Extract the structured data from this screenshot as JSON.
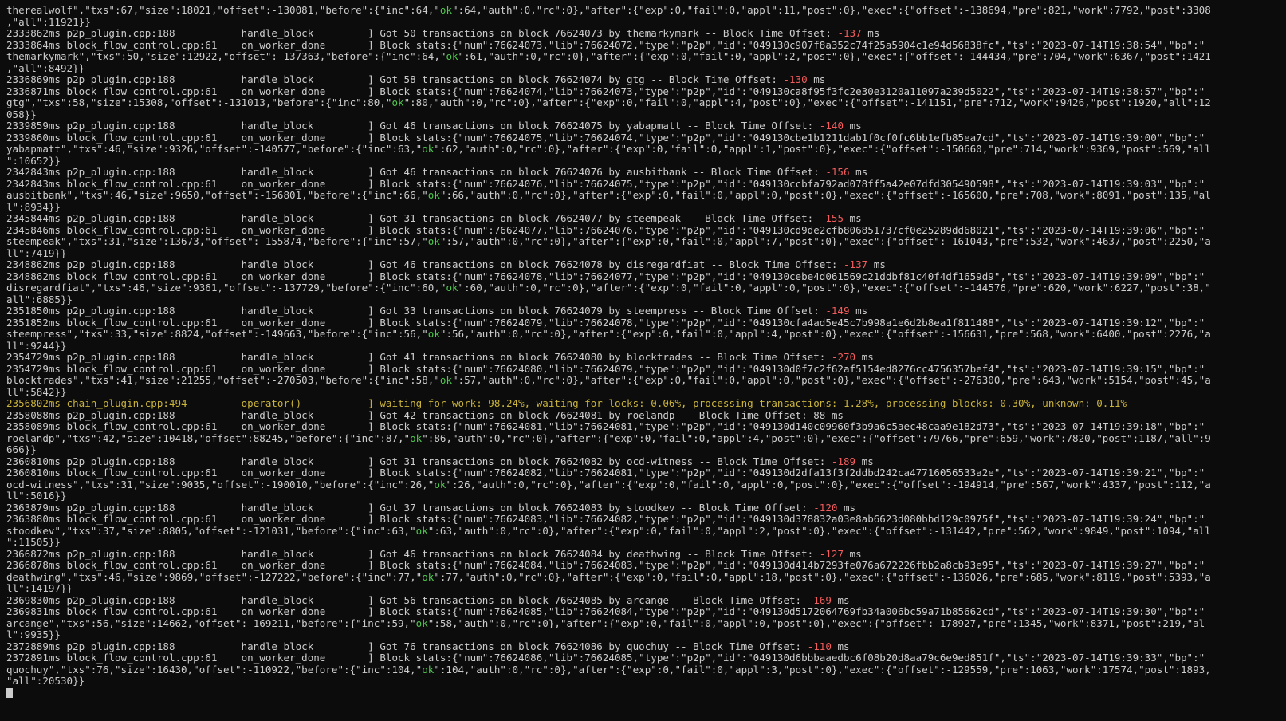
{
  "colors": {
    "background": "#0c0c0c",
    "text": "#cccccc",
    "ok": "#4ec94e",
    "offset_negative": "#f25c5c",
    "status_line": "#c9b33a"
  },
  "terminal": {
    "lines": [
      [
        {
          "t": "therealwolf\",\"txs\":67,\"size\":18021,\"offset\":-130081,\"before\":{\"inc\":64,\""
        },
        {
          "t": "ok",
          "c": "green"
        },
        {
          "t": "\":64,\"auth\":0,\"rc\":0},\"after\":{\"exp\":0,\"fail\":0,\"appl\":11,\"post\":0},\"exec\":{\"offset\":-138694,\"pre\":821,\"work\":7792,\"post\":3308"
        }
      ],
      [
        {
          "t": ",\"all\":11921}}"
        }
      ],
      [
        {
          "t": "2333862ms p2p_plugin.cpp:188           handle_block         ] Got 50 transactions on block 76624073 by themarkymark -- Block Time Offset: "
        },
        {
          "t": "-137",
          "c": "red"
        },
        {
          "t": " ms"
        }
      ],
      [
        {
          "t": "2333864ms block_flow_control.cpp:61    on_worker_done       ] Block stats:{\"num\":76624073,\"lib\":76624072,\"type\":\"p2p\",\"id\":\"049130c907f8a352c74f25a5904c1e94d56838fc\",\"ts\":\"2023-07-14T19:38:54\",\"bp\":\""
        }
      ],
      [
        {
          "t": "themarkymark\",\"txs\":50,\"size\":12922,\"offset\":-137363,\"before\":{\"inc\":64,\""
        },
        {
          "t": "ok",
          "c": "green"
        },
        {
          "t": "\":61,\"auth\":0,\"rc\":0},\"after\":{\"exp\":0,\"fail\":0,\"appl\":2,\"post\":0},\"exec\":{\"offset\":-144434,\"pre\":704,\"work\":6367,\"post\":1421"
        }
      ],
      [
        {
          "t": ",\"all\":8492}}"
        }
      ],
      [
        {
          "t": "2336869ms p2p_plugin.cpp:188           handle_block         ] Got 58 transactions on block 76624074 by gtg -- Block Time Offset: "
        },
        {
          "t": "-130",
          "c": "red"
        },
        {
          "t": " ms"
        }
      ],
      [
        {
          "t": "2336871ms block_flow_control.cpp:61    on_worker_done       ] Block stats:{\"num\":76624074,\"lib\":76624073,\"type\":\"p2p\",\"id\":\"049130ca8f95f3fc2e30e3120a11097a239d5022\",\"ts\":\"2023-07-14T19:38:57\",\"bp\":\""
        }
      ],
      [
        {
          "t": "gtg\",\"txs\":58,\"size\":15308,\"offset\":-131013,\"before\":{\"inc\":80,\""
        },
        {
          "t": "ok",
          "c": "green"
        },
        {
          "t": "\":80,\"auth\":0,\"rc\":0},\"after\":{\"exp\":0,\"fail\":0,\"appl\":4,\"post\":0},\"exec\":{\"offset\":-141151,\"pre\":712,\"work\":9426,\"post\":1920,\"all\":12"
        }
      ],
      [
        {
          "t": "058}}"
        }
      ],
      [
        {
          "t": "2339859ms p2p_plugin.cpp:188           handle_block         ] Got 46 transactions on block 76624075 by yabapmatt -- Block Time Offset: "
        },
        {
          "t": "-140",
          "c": "red"
        },
        {
          "t": " ms"
        }
      ],
      [
        {
          "t": "2339860ms block_flow_control.cpp:61    on_worker_done       ] Block stats:{\"num\":76624075,\"lib\":76624074,\"type\":\"p2p\",\"id\":\"049130cbe1b1211dab1f0cf0fc6bb1efb85ea7cd\",\"ts\":\"2023-07-14T19:39:00\",\"bp\":\""
        }
      ],
      [
        {
          "t": "yabapmatt\",\"txs\":46,\"size\":9326,\"offset\":-140577,\"before\":{\"inc\":63,\""
        },
        {
          "t": "ok",
          "c": "green"
        },
        {
          "t": "\":62,\"auth\":0,\"rc\":0},\"after\":{\"exp\":0,\"fail\":0,\"appl\":1,\"post\":0},\"exec\":{\"offset\":-150660,\"pre\":714,\"work\":9369,\"post\":569,\"all"
        }
      ],
      [
        {
          "t": "\":10652}}"
        }
      ],
      [
        {
          "t": "2342843ms p2p_plugin.cpp:188           handle_block         ] Got 46 transactions on block 76624076 by ausbitbank -- Block Time Offset: "
        },
        {
          "t": "-156",
          "c": "red"
        },
        {
          "t": " ms"
        }
      ],
      [
        {
          "t": "2342843ms block_flow_control.cpp:61    on_worker_done       ] Block stats:{\"num\":76624076,\"lib\":76624075,\"type\":\"p2p\",\"id\":\"049130ccbfa792ad078ff5a42e07dfd305490598\",\"ts\":\"2023-07-14T19:39:03\",\"bp\":\""
        }
      ],
      [
        {
          "t": "ausbitbank\",\"txs\":46,\"size\":9650,\"offset\":-156801,\"before\":{\"inc\":66,\""
        },
        {
          "t": "ok",
          "c": "green"
        },
        {
          "t": "\":66,\"auth\":0,\"rc\":0},\"after\":{\"exp\":0,\"fail\":0,\"appl\":0,\"post\":0},\"exec\":{\"offset\":-165600,\"pre\":708,\"work\":8091,\"post\":135,\"al"
        }
      ],
      [
        {
          "t": "l\":8934}}"
        }
      ],
      [
        {
          "t": "2345844ms p2p_plugin.cpp:188           handle_block         ] Got 31 transactions on block 76624077 by steempeak -- Block Time Offset: "
        },
        {
          "t": "-155",
          "c": "red"
        },
        {
          "t": " ms"
        }
      ],
      [
        {
          "t": "2345846ms block_flow_control.cpp:61    on_worker_done       ] Block stats:{\"num\":76624077,\"lib\":76624076,\"type\":\"p2p\",\"id\":\"049130cd9de2cfb806851737cf0e25289dd68021\",\"ts\":\"2023-07-14T19:39:06\",\"bp\":\""
        }
      ],
      [
        {
          "t": "steempeak\",\"txs\":31,\"size\":13673,\"offset\":-155874,\"before\":{\"inc\":57,\""
        },
        {
          "t": "ok",
          "c": "green"
        },
        {
          "t": "\":57,\"auth\":0,\"rc\":0},\"after\":{\"exp\":0,\"fail\":0,\"appl\":7,\"post\":0},\"exec\":{\"offset\":-161043,\"pre\":532,\"work\":4637,\"post\":2250,\"a"
        }
      ],
      [
        {
          "t": "ll\":7419}}"
        }
      ],
      [
        {
          "t": "2348862ms p2p_plugin.cpp:188           handle_block         ] Got 46 transactions on block 76624078 by disregardfiat -- Block Time Offset: "
        },
        {
          "t": "-137",
          "c": "red"
        },
        {
          "t": " ms"
        }
      ],
      [
        {
          "t": "2348862ms block_flow_control.cpp:61    on_worker_done       ] Block stats:{\"num\":76624078,\"lib\":76624077,\"type\":\"p2p\",\"id\":\"049130cebe4d061569c21ddbf81c40f4df1659d9\",\"ts\":\"2023-07-14T19:39:09\",\"bp\":\""
        }
      ],
      [
        {
          "t": "disregardfiat\",\"txs\":46,\"size\":9361,\"offset\":-137729,\"before\":{\"inc\":60,\""
        },
        {
          "t": "ok",
          "c": "green"
        },
        {
          "t": "\":60,\"auth\":0,\"rc\":0},\"after\":{\"exp\":0,\"fail\":0,\"appl\":0,\"post\":0},\"exec\":{\"offset\":-144576,\"pre\":620,\"work\":6227,\"post\":38,\""
        }
      ],
      [
        {
          "t": "all\":6885}}"
        }
      ],
      [
        {
          "t": "2351850ms p2p_plugin.cpp:188           handle_block         ] Got 33 transactions on block 76624079 by steempress -- Block Time Offset: "
        },
        {
          "t": "-149",
          "c": "red"
        },
        {
          "t": " ms"
        }
      ],
      [
        {
          "t": "2351852ms block_flow_control.cpp:61    on_worker_done       ] Block stats:{\"num\":76624079,\"lib\":76624078,\"type\":\"p2p\",\"id\":\"049130cfa4ad5e45c7b998a1e6d2b8ea1f811488\",\"ts\":\"2023-07-14T19:39:12\",\"bp\":\""
        }
      ],
      [
        {
          "t": "steempress\",\"txs\":33,\"size\":8824,\"offset\":-149663,\"before\":{\"inc\":56,\""
        },
        {
          "t": "ok",
          "c": "green"
        },
        {
          "t": "\":56,\"auth\":0,\"rc\":0},\"after\":{\"exp\":0,\"fail\":0,\"appl\":4,\"post\":0},\"exec\":{\"offset\":-156631,\"pre\":568,\"work\":6400,\"post\":2276,\"a"
        }
      ],
      [
        {
          "t": "ll\":9244}}"
        }
      ],
      [
        {
          "t": "2354729ms p2p_plugin.cpp:188           handle_block         ] Got 41 transactions on block 76624080 by blocktrades -- Block Time Offset: "
        },
        {
          "t": "-270",
          "c": "red"
        },
        {
          "t": " ms"
        }
      ],
      [
        {
          "t": "2354729ms block_flow_control.cpp:61    on_worker_done       ] Block stats:{\"num\":76624080,\"lib\":76624079,\"type\":\"p2p\",\"id\":\"049130d0f7c2f62af5154ed8276cc4756357bef4\",\"ts\":\"2023-07-14T19:39:15\",\"bp\":\""
        }
      ],
      [
        {
          "t": "blocktrades\",\"txs\":41,\"size\":21255,\"offset\":-270503,\"before\":{\"inc\":58,\""
        },
        {
          "t": "ok",
          "c": "green"
        },
        {
          "t": "\":57,\"auth\":0,\"rc\":0},\"after\":{\"exp\":0,\"fail\":0,\"appl\":0,\"post\":0},\"exec\":{\"offset\":-276300,\"pre\":643,\"work\":5154,\"post\":45,\"a"
        }
      ],
      [
        {
          "t": "ll\":5842}}"
        }
      ],
      [
        {
          "t": "2356802ms chain_plugin.cpp:494         operator()           ] waiting for work: 98.24%, waiting for locks: 0.06%, processing transactions: 1.28%, processing blocks: 0.30%, unknown: 0.11%",
          "c": "yellow"
        }
      ],
      [
        {
          "t": "2358088ms p2p_plugin.cpp:188           handle_block         ] Got 42 transactions on block 76624081 by roelandp -- Block Time Offset: 88 ms"
        }
      ],
      [
        {
          "t": "2358089ms block_flow_control.cpp:61    on_worker_done       ] Block stats:{\"num\":76624081,\"lib\":76624081,\"type\":\"p2p\",\"id\":\"049130d140c09960f3b9a6c5aec48caa9e182d73\",\"ts\":\"2023-07-14T19:39:18\",\"bp\":\""
        }
      ],
      [
        {
          "t": "roelandp\",\"txs\":42,\"size\":10418,\"offset\":88245,\"before\":{\"inc\":87,\""
        },
        {
          "t": "ok",
          "c": "green"
        },
        {
          "t": "\":86,\"auth\":0,\"rc\":0},\"after\":{\"exp\":0,\"fail\":0,\"appl\":4,\"post\":0},\"exec\":{\"offset\":79766,\"pre\":659,\"work\":7820,\"post\":1187,\"all\":9"
        }
      ],
      [
        {
          "t": "666}}"
        }
      ],
      [
        {
          "t": "2360810ms p2p_plugin.cpp:188           handle_block         ] Got 31 transactions on block 76624082 by ocd-witness -- Block Time Offset: "
        },
        {
          "t": "-189",
          "c": "red"
        },
        {
          "t": " ms"
        }
      ],
      [
        {
          "t": "2360810ms block_flow_control.cpp:61    on_worker_done       ] Block stats:{\"num\":76624082,\"lib\":76624081,\"type\":\"p2p\",\"id\":\"049130d2dfa13f3f2ddbd242ca47716056533a2e\",\"ts\":\"2023-07-14T19:39:21\",\"bp\":\""
        }
      ],
      [
        {
          "t": "ocd-witness\",\"txs\":31,\"size\":9035,\"offset\":-190010,\"before\":{\"inc\":26,\""
        },
        {
          "t": "ok",
          "c": "green"
        },
        {
          "t": "\":26,\"auth\":0,\"rc\":0},\"after\":{\"exp\":0,\"fail\":0,\"appl\":0,\"post\":0},\"exec\":{\"offset\":-194914,\"pre\":567,\"work\":4337,\"post\":112,\"a"
        }
      ],
      [
        {
          "t": "ll\":5016}}"
        }
      ],
      [
        {
          "t": "2363879ms p2p_plugin.cpp:188           handle_block         ] Got 37 transactions on block 76624083 by stoodkev -- Block Time Offset: "
        },
        {
          "t": "-120",
          "c": "red"
        },
        {
          "t": " ms"
        }
      ],
      [
        {
          "t": "2363880ms block_flow_control.cpp:61    on_worker_done       ] Block stats:{\"num\":76624083,\"lib\":76624082,\"type\":\"p2p\",\"id\":\"049130d378832a03e8ab6623d080bbd129c0975f\",\"ts\":\"2023-07-14T19:39:24\",\"bp\":\""
        }
      ],
      [
        {
          "t": "stoodkev\",\"txs\":37,\"size\":8805,\"offset\":-121031,\"before\":{\"inc\":63,\""
        },
        {
          "t": "ok",
          "c": "green"
        },
        {
          "t": "\":63,\"auth\":0,\"rc\":0},\"after\":{\"exp\":0,\"fail\":0,\"appl\":2,\"post\":0},\"exec\":{\"offset\":-131442,\"pre\":562,\"work\":9849,\"post\":1094,\"all"
        }
      ],
      [
        {
          "t": "\":11505}}"
        }
      ],
      [
        {
          "t": "2366872ms p2p_plugin.cpp:188           handle_block         ] Got 46 transactions on block 76624084 by deathwing -- Block Time Offset: "
        },
        {
          "t": "-127",
          "c": "red"
        },
        {
          "t": " ms"
        }
      ],
      [
        {
          "t": "2366878ms block_flow_control.cpp:61    on_worker_done       ] Block stats:{\"num\":76624084,\"lib\":76624083,\"type\":\"p2p\",\"id\":\"049130d414b7293fe076a672226fbb2a8cb93e95\",\"ts\":\"2023-07-14T19:39:27\",\"bp\":\""
        }
      ],
      [
        {
          "t": "deathwing\",\"txs\":46,\"size\":9869,\"offset\":-127222,\"before\":{\"inc\":77,\""
        },
        {
          "t": "ok",
          "c": "green"
        },
        {
          "t": "\":77,\"auth\":0,\"rc\":0},\"after\":{\"exp\":0,\"fail\":0,\"appl\":18,\"post\":0},\"exec\":{\"offset\":-136026,\"pre\":685,\"work\":8119,\"post\":5393,\"a"
        }
      ],
      [
        {
          "t": "ll\":14197}}"
        }
      ],
      [
        {
          "t": "2369830ms p2p_plugin.cpp:188           handle_block         ] Got 56 transactions on block 76624085 by arcange -- Block Time Offset: "
        },
        {
          "t": "-169",
          "c": "red"
        },
        {
          "t": " ms"
        }
      ],
      [
        {
          "t": "2369831ms block_flow_control.cpp:61    on_worker_done       ] Block stats:{\"num\":76624085,\"lib\":76624084,\"type\":\"p2p\",\"id\":\"049130d5172064769fb34a006bc59a71b85662cd\",\"ts\":\"2023-07-14T19:39:30\",\"bp\":\""
        }
      ],
      [
        {
          "t": "arcange\",\"txs\":56,\"size\":14662,\"offset\":-169211,\"before\":{\"inc\":59,\""
        },
        {
          "t": "ok",
          "c": "green"
        },
        {
          "t": "\":58,\"auth\":0,\"rc\":0},\"after\":{\"exp\":0,\"fail\":0,\"appl\":0,\"post\":0},\"exec\":{\"offset\":-178927,\"pre\":1345,\"work\":8371,\"post\":219,\"al"
        }
      ],
      [
        {
          "t": "l\":9935}}"
        }
      ],
      [
        {
          "t": "2372889ms p2p_plugin.cpp:188           handle_block         ] Got 76 transactions on block 76624086 by quochuy -- Block Time Offset: "
        },
        {
          "t": "-110",
          "c": "red"
        },
        {
          "t": " ms"
        }
      ],
      [
        {
          "t": "2372891ms block_flow_control.cpp:61    on_worker_done       ] Block stats:{\"num\":76624086,\"lib\":76624085,\"type\":\"p2p\",\"id\":\"049130d6bbbaaedbc6f08b20d8aa79c6e9ed851f\",\"ts\":\"2023-07-14T19:39:33\",\"bp\":\""
        }
      ],
      [
        {
          "t": "quochuy\",\"txs\":76,\"size\":16430,\"offset\":-110922,\"before\":{\"inc\":104,\""
        },
        {
          "t": "ok",
          "c": "green"
        },
        {
          "t": "\":104,\"auth\":0,\"rc\":0},\"after\":{\"exp\":0,\"fail\":0,\"appl\":3,\"post\":0},\"exec\":{\"offset\":-129559,\"pre\":1063,\"work\":17574,\"post\":1893,"
        }
      ],
      [
        {
          "t": "\"all\":20530}}"
        }
      ]
    ]
  }
}
